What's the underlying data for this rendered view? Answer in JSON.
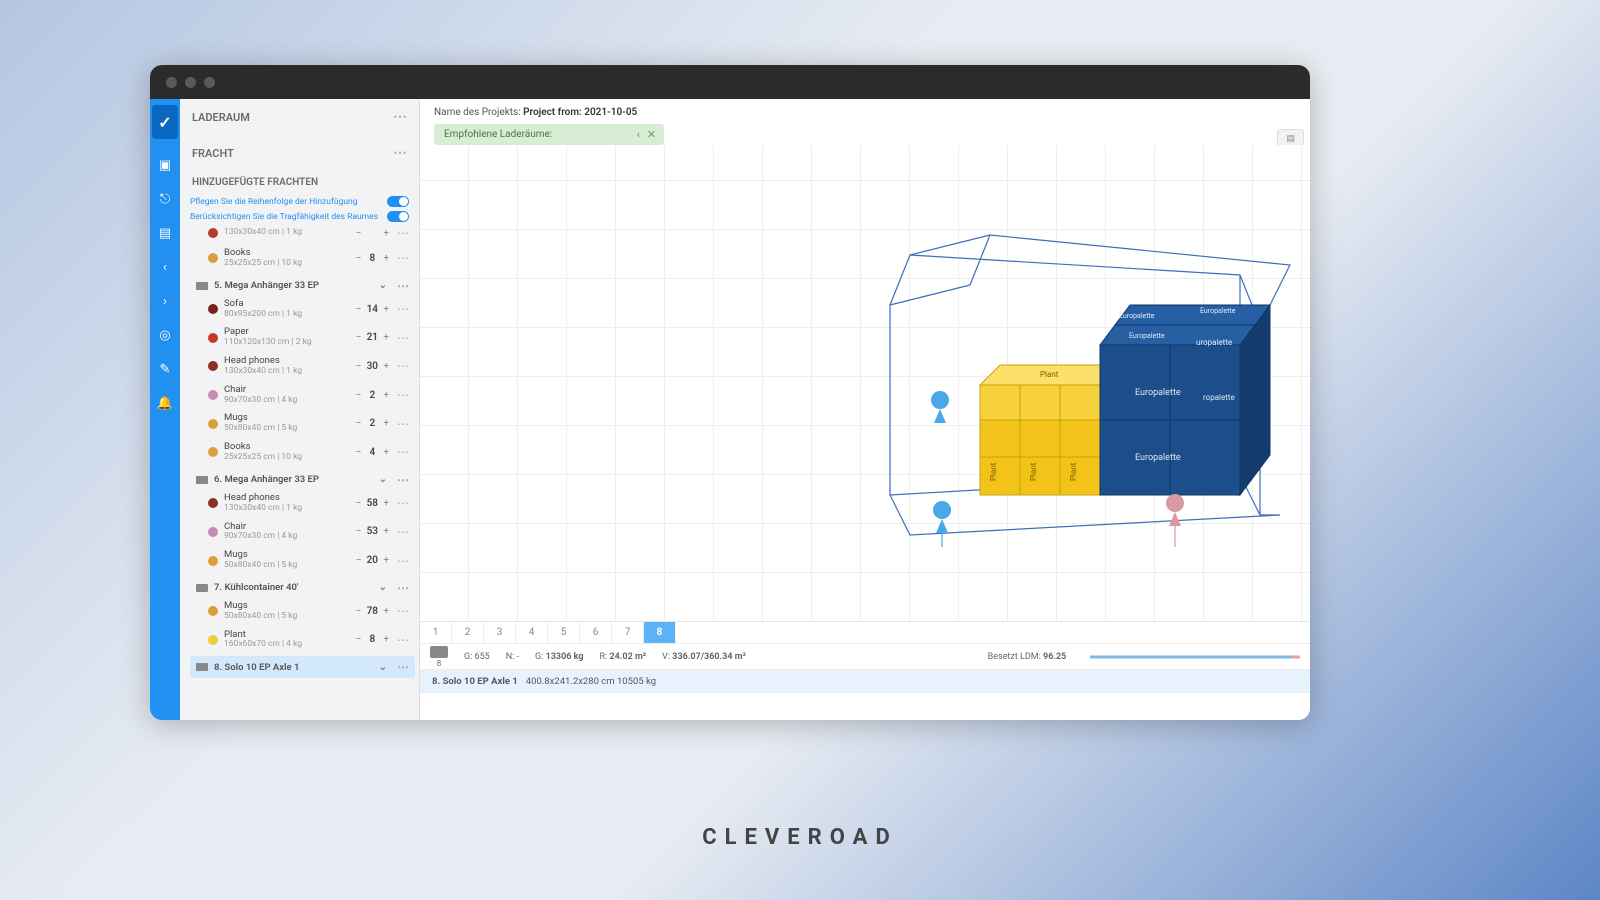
{
  "brand": "CLEVEROAD",
  "project": {
    "label": "Name des Projekts:",
    "value": "Project from: 2021-10-05"
  },
  "banner": {
    "text": "Empfohlene Laderäume:"
  },
  "sidebar": {
    "section_laderaum": "LADERAUM",
    "section_fracht": "FRACHT",
    "section_added": "HINZUGEFÜGTE FRACHTEN",
    "toggle_order": "Pflegen Sie die Reihenfolge der Hinzufügung",
    "toggle_capacity": "Berücksichtigen Sie die Tragfähigkeit des Raumes"
  },
  "groups": [
    {
      "open": true,
      "leading_tail": true,
      "items": [
        {
          "color": "#b53a2e",
          "name": "",
          "dims": "130x30x40 cm | 1 kg",
          "qty": ""
        },
        {
          "color": "#d9a03a",
          "name": "Books",
          "dims": "25x25x25 cm | 10 kg",
          "qty": "8"
        }
      ]
    },
    {
      "title": "5. Mega Anhänger 33 EP",
      "open": true,
      "items": [
        {
          "color": "#7a2219",
          "name": "Sofa",
          "dims": "80x95x200 cm | 1 kg",
          "qty": "14"
        },
        {
          "color": "#c0392b",
          "name": "Paper",
          "dims": "110x120x130 cm | 2 kg",
          "qty": "21"
        },
        {
          "color": "#8e2f25",
          "name": "Head phones",
          "dims": "130x30x40 cm | 1 kg",
          "qty": "30"
        },
        {
          "color": "#c48bb4",
          "name": "Chair",
          "dims": "90x70x30 cm | 4 kg",
          "qty": "2"
        },
        {
          "color": "#d9a03a",
          "name": "Mugs",
          "dims": "50x80x40 cm | 5 kg",
          "qty": "2"
        },
        {
          "color": "#d9a03a",
          "name": "Books",
          "dims": "25x25x25 cm | 10 kg",
          "qty": "4"
        }
      ]
    },
    {
      "title": "6. Mega Anhänger 33 EP",
      "open": true,
      "items": [
        {
          "color": "#8e2f25",
          "name": "Head phones",
          "dims": "130x30x40 cm | 1 kg",
          "qty": "58"
        },
        {
          "color": "#c48bb4",
          "name": "Chair",
          "dims": "90x70x30 cm | 4 kg",
          "qty": "53"
        },
        {
          "color": "#d9a03a",
          "name": "Mugs",
          "dims": "50x80x40 cm | 5 kg",
          "qty": "20"
        }
      ]
    },
    {
      "title": "7. Kühlcontainer 40'",
      "open": true,
      "items": [
        {
          "color": "#d9a03a",
          "name": "Mugs",
          "dims": "50x80x40 cm | 5 kg",
          "qty": "78"
        },
        {
          "color": "#e9cf3a",
          "name": "Plant",
          "dims": "160x60x70 cm | 4 kg",
          "qty": "8"
        }
      ]
    },
    {
      "title": "8. Solo 10 EP Axle 1",
      "open": false,
      "items": [],
      "selected": true
    }
  ],
  "pager": {
    "pages": [
      "1",
      "2",
      "3",
      "4",
      "5",
      "6",
      "7",
      "8"
    ],
    "active": "8"
  },
  "stats": {
    "count_label": "8",
    "g": "G: 655",
    "n": "N: -",
    "gtot_label": "G:",
    "gtot_val": "13306 kg",
    "r_label": "R:",
    "r_val": "24.02 m²",
    "v_label": "V:",
    "v_val": "336.07/360.34 m³",
    "ldm_label": "Besetzt LDM:",
    "ldm_val": "96.25"
  },
  "detail": {
    "name": "8. Solo 10 EP Axle 1",
    "dims": "400.8x241.2x280 cm 10505 kg"
  },
  "right_btn": "LEFT",
  "boxlabels": {
    "plant": "Plant",
    "europalette": "Europalette",
    "ropalette": "ropalette",
    "uropalette": "uropalette"
  }
}
